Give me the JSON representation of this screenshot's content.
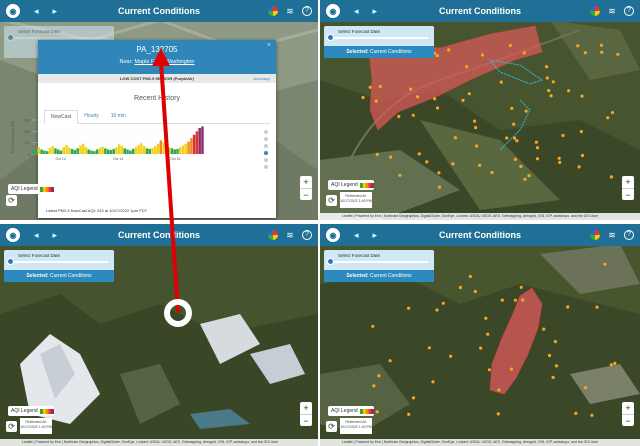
{
  "header": {
    "title": "Current Conditions"
  },
  "forecast": {
    "label": "Select Forecast Date",
    "selected_prefix": "Selected:",
    "selected_value": "Current Conditions"
  },
  "legend": {
    "label": "AQI Legend"
  },
  "refresh": {
    "text": "Refreshed At: 10/17/2022 1:40 PM"
  },
  "zoom": {
    "in": "+",
    "out": "−"
  },
  "attribution": "Leaflet | Powered by Esri | Earthstar Geographics, DigitalGlobe, GeoEye, i-cubed, USDA, USGS, AEX, Getmapping, Aerogrid, IGN, IGP, swisstopo, and the GIS User",
  "popup": {
    "id": "PA_132705",
    "near_label": "Near:",
    "near_place": "Maple Falls, Washington",
    "sensor": "LOW COST PM2.5 SENSOR (PurpleAir)",
    "sensor_link": "Accuracy",
    "recent_history": "Recent History",
    "tabs": [
      "NowCast",
      "Hourly",
      "10 min"
    ],
    "latest": "Latest PM2.5 NowCast AQI: 243 at 10/17/2022 1pm PDT",
    "close": "×"
  },
  "chart_data": {
    "type": "bar",
    "ylabel": "PM2.5 NowCast AQI",
    "ylim": [
      0,
      300
    ],
    "yticks": [
      "300",
      "200",
      "100",
      "0"
    ],
    "xticks": [
      "Oct 12",
      "Oct 14",
      "Oct 16"
    ],
    "values": [
      35,
      45,
      60,
      40,
      30,
      25,
      55,
      70,
      50,
      40,
      30,
      60,
      80,
      55,
      45,
      35,
      50,
      75,
      90,
      60,
      40,
      30,
      25,
      40,
      55,
      65,
      50,
      40,
      35,
      45,
      60,
      85,
      70,
      50,
      40,
      30,
      45,
      60,
      80,
      95,
      70,
      50,
      45,
      55,
      70,
      90,
      120,
      100,
      80,
      60,
      50,
      40,
      45,
      60,
      75,
      90,
      110,
      140,
      170,
      200,
      230,
      243
    ]
  },
  "colors": {
    "header": "#1f6f96",
    "smoke": "#e05a5a",
    "sensor": "#f5a623",
    "arrow": "#e00000"
  }
}
